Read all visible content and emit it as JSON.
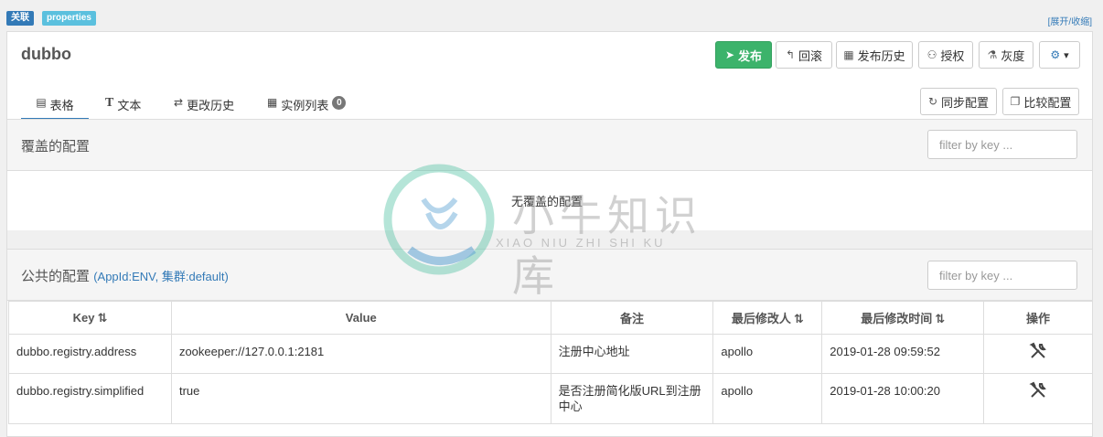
{
  "top": {
    "badge_relation": "关联",
    "badge_properties": "properties",
    "toggle": "[展开/收缩]"
  },
  "namespace": {
    "title": "dubbo"
  },
  "toolbar": {
    "publish": "发布",
    "rollback": "回滚",
    "history": "发布历史",
    "grant": "授权",
    "gray": "灰度",
    "settings_caret": "▾"
  },
  "tabs": {
    "table": "表格",
    "text": "文本",
    "history": "更改历史",
    "instances": "实例列表",
    "instance_count": "0"
  },
  "actions": {
    "sync": "同步配置",
    "compare": "比较配置"
  },
  "override": {
    "title": "覆盖的配置",
    "filter_placeholder": "filter by key ...",
    "empty": "无覆盖的配置"
  },
  "public": {
    "title": "公共的配置",
    "subtitle": "(AppId:ENV, 集群:default)",
    "filter_placeholder": "filter by key ..."
  },
  "table": {
    "headers": {
      "key": "Key",
      "value": "Value",
      "comment": "备注",
      "modifier": "最后修改人",
      "time": "最后修改时间",
      "op": "操作"
    },
    "rows": [
      {
        "key": "dubbo.registry.address",
        "value": "zookeeper://127.0.0.1:2181",
        "comment": "注册中心地址",
        "modifier": "apollo",
        "time": "2019-01-28 09:59:52"
      },
      {
        "key": "dubbo.registry.simplified",
        "value": "true",
        "comment": "是否注册简化版URL到注册中心",
        "modifier": "apollo",
        "time": "2019-01-28 10:00:20"
      }
    ]
  },
  "watermark": {
    "cn": "小牛知识库",
    "en": "XIAO NIU ZHI SHI KU"
  },
  "colors": {
    "primary": "#3cb36b",
    "link": "#337ab7",
    "info": "#5bc0de"
  },
  "icons": [
    "send-icon",
    "undo-icon",
    "calendar-icon",
    "user-icon",
    "flask-icon",
    "gear-icon",
    "table-icon",
    "text-icon",
    "transfer-icon",
    "list-icon",
    "refresh-icon",
    "copy-icon",
    "wrench-icon"
  ]
}
